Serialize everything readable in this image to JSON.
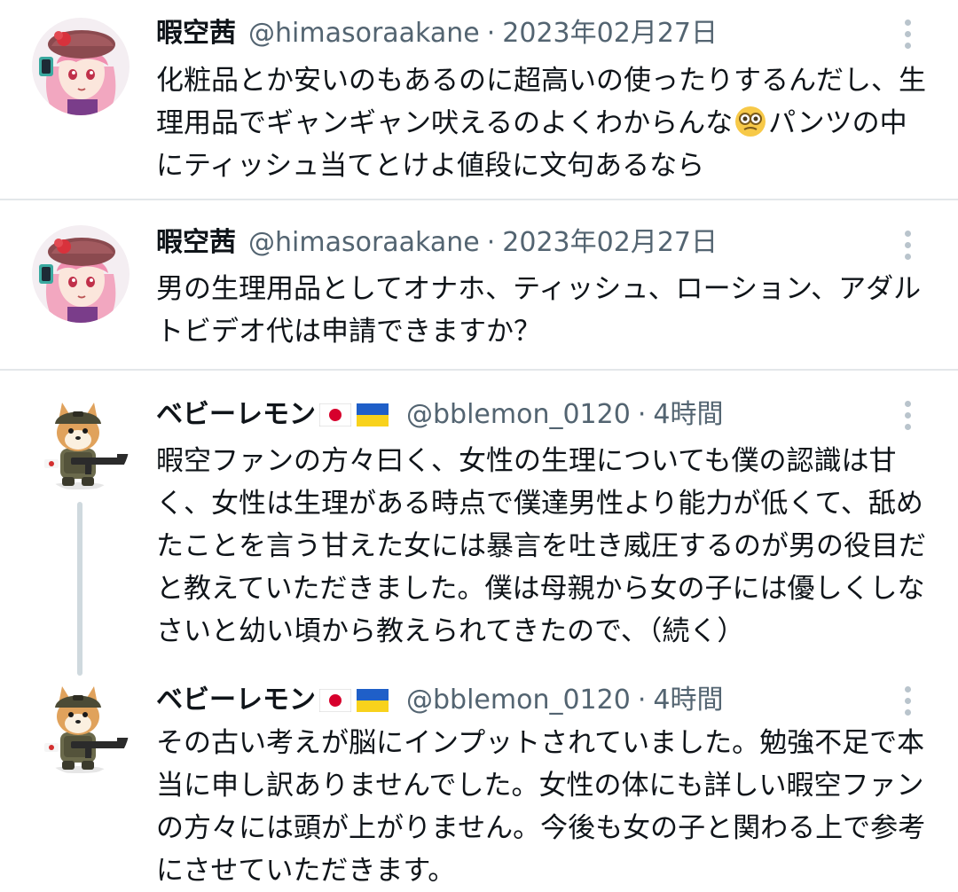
{
  "tweets": [
    {
      "name": "暇空茜",
      "handle": "@himasoraakane",
      "separator": "·",
      "time": "2023年02月27日",
      "lines": [
        "化粧品とか安いのもあるのに超高いの使ったりするんだし、生",
        "理用品でギャンギャン吠えるのよくわからんな",
        "パンツの中",
        "にティッシュ当てとけよ値段に文句あるなら"
      ],
      "emoji": "face-with-monocle-emoji"
    },
    {
      "name": "暇空茜",
      "handle": "@himasoraakane",
      "separator": "·",
      "time": "2023年02月27日",
      "lines": [
        "男の生理用品としてオナホ、ティッシュ、ローション、アダル",
        "トビデオ代は申請できますか？"
      ]
    },
    {
      "name": "ベビーレモン",
      "flags": [
        "japan-flag-emoji",
        "ukraine-flag-emoji"
      ],
      "handle": "@bblemon_0120",
      "separator": "·",
      "time": "4時間",
      "lines": [
        "暇空ファンの方々曰く、女性の生理についても僕の認識は甘",
        "く、女性は生理がある時点で僕達男性より能力が低くて、舐め",
        "たことを言う甘えた女には暴言を吐き威圧するのが男の役目だ",
        "と教えていただきました。僕は母親から女の子には優しくしな",
        "さいと幼い頃から教えられてきたので、（続く）"
      ]
    },
    {
      "name": "ベビーレモン",
      "flags": [
        "japan-flag-emoji",
        "ukraine-flag-emoji"
      ],
      "handle": "@bblemon_0120",
      "separator": "·",
      "time": "4時間",
      "lines": [
        "その古い考えが脳にインプットされていました。勉強不足で本",
        "当に申し訳ありませんでした。女性の体にも詳しい暇空ファン",
        "の方々には頭が上がりません。今後も女の子と関わる上で参考",
        "にさせていただきます。"
      ]
    }
  ],
  "colors": {
    "text": "#0f1419",
    "secondary": "#536471",
    "divider": "#e3e7ea",
    "thread_line": "#cfd9de"
  }
}
